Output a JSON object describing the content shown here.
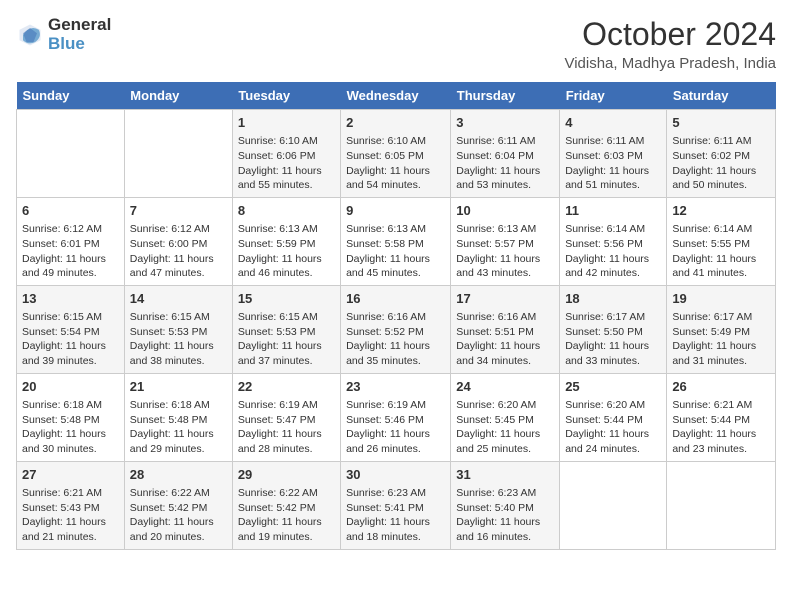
{
  "header": {
    "logo_general": "General",
    "logo_blue": "Blue",
    "title": "October 2024",
    "subtitle": "Vidisha, Madhya Pradesh, India"
  },
  "weekdays": [
    "Sunday",
    "Monday",
    "Tuesday",
    "Wednesday",
    "Thursday",
    "Friday",
    "Saturday"
  ],
  "weeks": [
    [
      {
        "day": "",
        "sunrise": "",
        "sunset": "",
        "daylight": ""
      },
      {
        "day": "",
        "sunrise": "",
        "sunset": "",
        "daylight": ""
      },
      {
        "day": "1",
        "sunrise": "Sunrise: 6:10 AM",
        "sunset": "Sunset: 6:06 PM",
        "daylight": "Daylight: 11 hours and 55 minutes."
      },
      {
        "day": "2",
        "sunrise": "Sunrise: 6:10 AM",
        "sunset": "Sunset: 6:05 PM",
        "daylight": "Daylight: 11 hours and 54 minutes."
      },
      {
        "day": "3",
        "sunrise": "Sunrise: 6:11 AM",
        "sunset": "Sunset: 6:04 PM",
        "daylight": "Daylight: 11 hours and 53 minutes."
      },
      {
        "day": "4",
        "sunrise": "Sunrise: 6:11 AM",
        "sunset": "Sunset: 6:03 PM",
        "daylight": "Daylight: 11 hours and 51 minutes."
      },
      {
        "day": "5",
        "sunrise": "Sunrise: 6:11 AM",
        "sunset": "Sunset: 6:02 PM",
        "daylight": "Daylight: 11 hours and 50 minutes."
      }
    ],
    [
      {
        "day": "6",
        "sunrise": "Sunrise: 6:12 AM",
        "sunset": "Sunset: 6:01 PM",
        "daylight": "Daylight: 11 hours and 49 minutes."
      },
      {
        "day": "7",
        "sunrise": "Sunrise: 6:12 AM",
        "sunset": "Sunset: 6:00 PM",
        "daylight": "Daylight: 11 hours and 47 minutes."
      },
      {
        "day": "8",
        "sunrise": "Sunrise: 6:13 AM",
        "sunset": "Sunset: 5:59 PM",
        "daylight": "Daylight: 11 hours and 46 minutes."
      },
      {
        "day": "9",
        "sunrise": "Sunrise: 6:13 AM",
        "sunset": "Sunset: 5:58 PM",
        "daylight": "Daylight: 11 hours and 45 minutes."
      },
      {
        "day": "10",
        "sunrise": "Sunrise: 6:13 AM",
        "sunset": "Sunset: 5:57 PM",
        "daylight": "Daylight: 11 hours and 43 minutes."
      },
      {
        "day": "11",
        "sunrise": "Sunrise: 6:14 AM",
        "sunset": "Sunset: 5:56 PM",
        "daylight": "Daylight: 11 hours and 42 minutes."
      },
      {
        "day": "12",
        "sunrise": "Sunrise: 6:14 AM",
        "sunset": "Sunset: 5:55 PM",
        "daylight": "Daylight: 11 hours and 41 minutes."
      }
    ],
    [
      {
        "day": "13",
        "sunrise": "Sunrise: 6:15 AM",
        "sunset": "Sunset: 5:54 PM",
        "daylight": "Daylight: 11 hours and 39 minutes."
      },
      {
        "day": "14",
        "sunrise": "Sunrise: 6:15 AM",
        "sunset": "Sunset: 5:53 PM",
        "daylight": "Daylight: 11 hours and 38 minutes."
      },
      {
        "day": "15",
        "sunrise": "Sunrise: 6:15 AM",
        "sunset": "Sunset: 5:53 PM",
        "daylight": "Daylight: 11 hours and 37 minutes."
      },
      {
        "day": "16",
        "sunrise": "Sunrise: 6:16 AM",
        "sunset": "Sunset: 5:52 PM",
        "daylight": "Daylight: 11 hours and 35 minutes."
      },
      {
        "day": "17",
        "sunrise": "Sunrise: 6:16 AM",
        "sunset": "Sunset: 5:51 PM",
        "daylight": "Daylight: 11 hours and 34 minutes."
      },
      {
        "day": "18",
        "sunrise": "Sunrise: 6:17 AM",
        "sunset": "Sunset: 5:50 PM",
        "daylight": "Daylight: 11 hours and 33 minutes."
      },
      {
        "day": "19",
        "sunrise": "Sunrise: 6:17 AM",
        "sunset": "Sunset: 5:49 PM",
        "daylight": "Daylight: 11 hours and 31 minutes."
      }
    ],
    [
      {
        "day": "20",
        "sunrise": "Sunrise: 6:18 AM",
        "sunset": "Sunset: 5:48 PM",
        "daylight": "Daylight: 11 hours and 30 minutes."
      },
      {
        "day": "21",
        "sunrise": "Sunrise: 6:18 AM",
        "sunset": "Sunset: 5:48 PM",
        "daylight": "Daylight: 11 hours and 29 minutes."
      },
      {
        "day": "22",
        "sunrise": "Sunrise: 6:19 AM",
        "sunset": "Sunset: 5:47 PM",
        "daylight": "Daylight: 11 hours and 28 minutes."
      },
      {
        "day": "23",
        "sunrise": "Sunrise: 6:19 AM",
        "sunset": "Sunset: 5:46 PM",
        "daylight": "Daylight: 11 hours and 26 minutes."
      },
      {
        "day": "24",
        "sunrise": "Sunrise: 6:20 AM",
        "sunset": "Sunset: 5:45 PM",
        "daylight": "Daylight: 11 hours and 25 minutes."
      },
      {
        "day": "25",
        "sunrise": "Sunrise: 6:20 AM",
        "sunset": "Sunset: 5:44 PM",
        "daylight": "Daylight: 11 hours and 24 minutes."
      },
      {
        "day": "26",
        "sunrise": "Sunrise: 6:21 AM",
        "sunset": "Sunset: 5:44 PM",
        "daylight": "Daylight: 11 hours and 23 minutes."
      }
    ],
    [
      {
        "day": "27",
        "sunrise": "Sunrise: 6:21 AM",
        "sunset": "Sunset: 5:43 PM",
        "daylight": "Daylight: 11 hours and 21 minutes."
      },
      {
        "day": "28",
        "sunrise": "Sunrise: 6:22 AM",
        "sunset": "Sunset: 5:42 PM",
        "daylight": "Daylight: 11 hours and 20 minutes."
      },
      {
        "day": "29",
        "sunrise": "Sunrise: 6:22 AM",
        "sunset": "Sunset: 5:42 PM",
        "daylight": "Daylight: 11 hours and 19 minutes."
      },
      {
        "day": "30",
        "sunrise": "Sunrise: 6:23 AM",
        "sunset": "Sunset: 5:41 PM",
        "daylight": "Daylight: 11 hours and 18 minutes."
      },
      {
        "day": "31",
        "sunrise": "Sunrise: 6:23 AM",
        "sunset": "Sunset: 5:40 PM",
        "daylight": "Daylight: 11 hours and 16 minutes."
      },
      {
        "day": "",
        "sunrise": "",
        "sunset": "",
        "daylight": ""
      },
      {
        "day": "",
        "sunrise": "",
        "sunset": "",
        "daylight": ""
      }
    ]
  ]
}
